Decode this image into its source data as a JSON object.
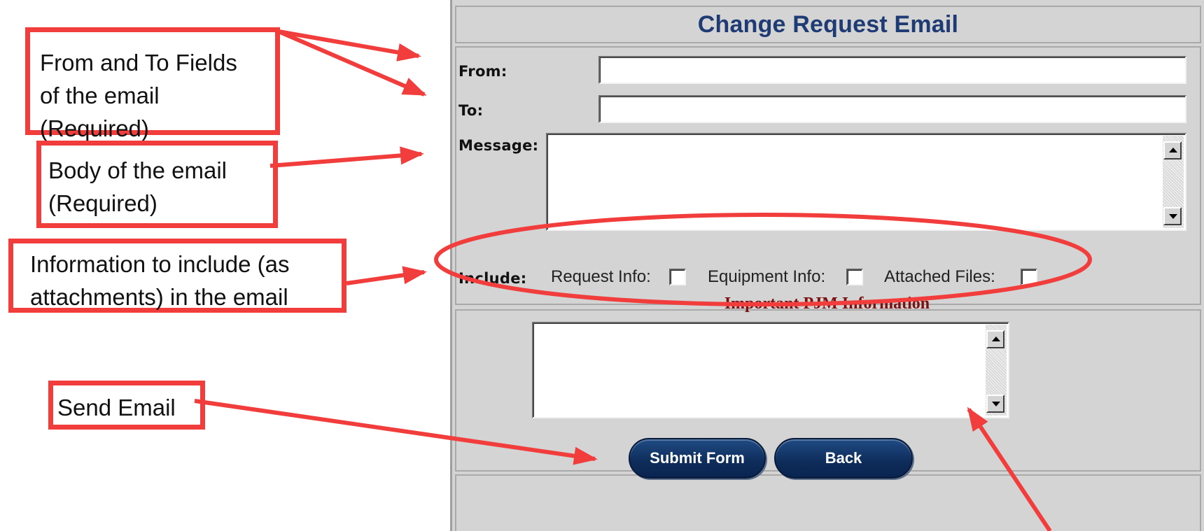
{
  "form": {
    "title": "Change Request Email",
    "from_label": "From:",
    "from_value": "",
    "to_label": "To:",
    "to_value": "",
    "message_label": "Message:",
    "message_value": "",
    "include_label": "Include:",
    "options": [
      {
        "label": "Request Info:",
        "checked": false
      },
      {
        "label": "Equipment Info:",
        "checked": false
      },
      {
        "label": "Attached Files:",
        "checked": false
      }
    ],
    "info_heading": "Important PJM Information",
    "info_value": "",
    "submit_label": "Submit Form",
    "back_label": "Back"
  },
  "annotations": {
    "from_to": [
      "From and To Fields",
      "of the email",
      "(Required)"
    ],
    "body": [
      "Body of the email",
      "(Required)"
    ],
    "include": [
      "Information to include (as",
      "attachments) in the email"
    ],
    "send": [
      "Send Email"
    ]
  },
  "colors": {
    "annotation_red": "#f23d3d",
    "title_blue": "#1f3b73",
    "heading_red": "#7a1010",
    "panel_gray": "#d4d4d4",
    "button_navy": "#0e2c5a"
  },
  "icons": [
    "scroll-up-arrow-icon",
    "scroll-down-arrow-icon"
  ]
}
